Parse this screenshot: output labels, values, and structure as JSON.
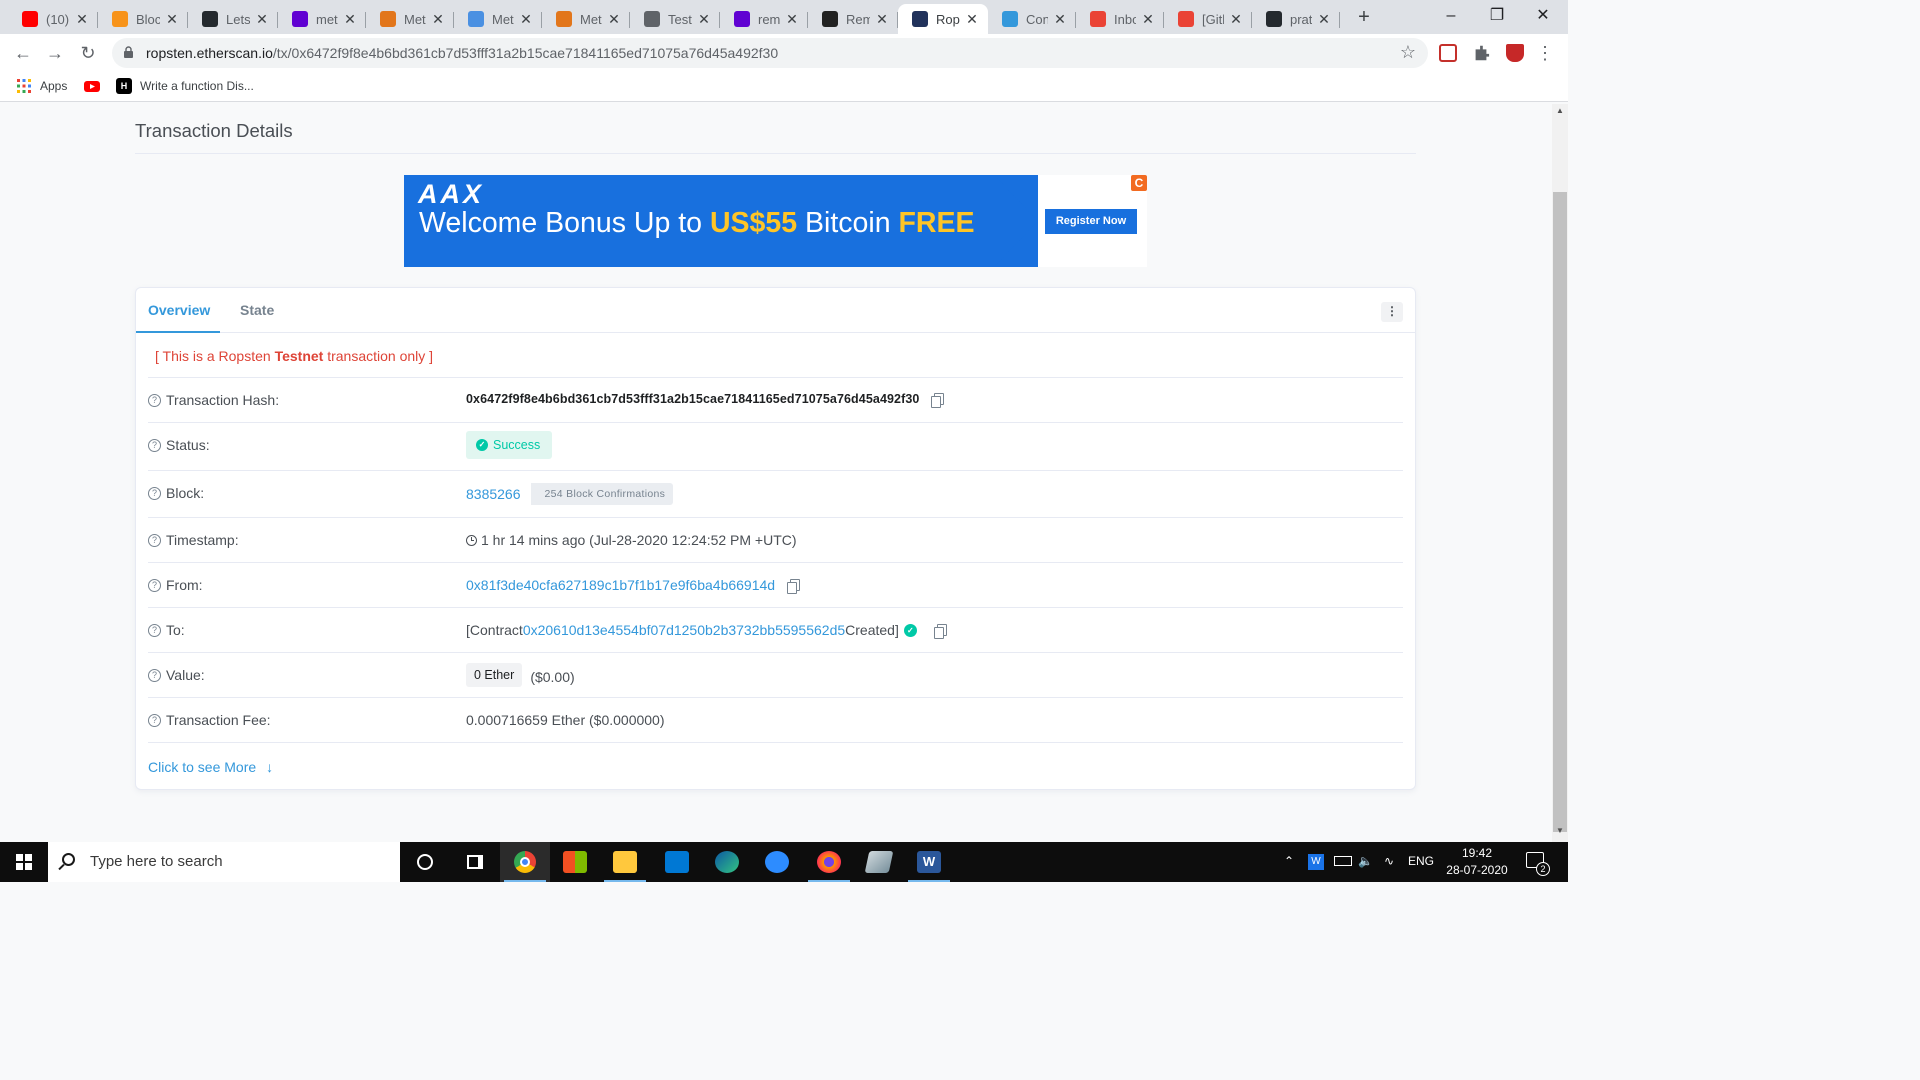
{
  "browser": {
    "tabs": [
      {
        "label": "(10)",
        "favicon": "youtube-icon",
        "color": "#ff0000",
        "active": false
      },
      {
        "label": "Bloc",
        "favicon": "blockchain-icon",
        "color": "#f7931a",
        "active": false
      },
      {
        "label": "Lets",
        "favicon": "github-icon",
        "color": "#24292e",
        "active": false
      },
      {
        "label": "met",
        "favicon": "yahoo-icon",
        "color": "#6001d2",
        "active": false
      },
      {
        "label": "Met",
        "favicon": "metamask-icon",
        "color": "#e2761b",
        "active": false
      },
      {
        "label": "Met",
        "favicon": "rainbow-icon",
        "color": "#4a90e2",
        "active": false
      },
      {
        "label": "Met",
        "favicon": "metamask-icon",
        "color": "#e2761b",
        "active": false
      },
      {
        "label": "Test",
        "favicon": "globe-icon",
        "color": "#5f6368",
        "active": false
      },
      {
        "label": "remi",
        "favicon": "yahoo-icon",
        "color": "#6001d2",
        "active": false
      },
      {
        "label": "Rem",
        "favicon": "remix-icon",
        "color": "#222222",
        "active": false
      },
      {
        "label": "Rop",
        "favicon": "etherscan-icon",
        "color": "#21325b",
        "active": true
      },
      {
        "label": "Con",
        "favicon": "etherscan-icon",
        "color": "#3498db",
        "active": false
      },
      {
        "label": "Inbo",
        "favicon": "gmail-icon",
        "color": "#ea4335",
        "active": false
      },
      {
        "label": "[Gith",
        "favicon": "gmail-icon",
        "color": "#ea4335",
        "active": false
      },
      {
        "label": "prat",
        "favicon": "github-icon",
        "color": "#24292e",
        "active": false
      }
    ],
    "url_host": "ropsten.etherscan.io",
    "url_path": "/tx/0x6472f9f8e4b6bd361cb7d53fff31a2b15cae71841165ed71075a76d45a492f30",
    "bookmarks": [
      {
        "label": "Apps",
        "icon": "apps-grid-icon"
      },
      {
        "label": "",
        "icon": "youtube-icon"
      },
      {
        "label": "Write a function Dis...",
        "icon": "hackerearth-icon"
      }
    ]
  },
  "page": {
    "title": "Transaction Details",
    "ad": {
      "logo": "AAX",
      "headline_pre": "Welcome Bonus Up to ",
      "headline_amount": "US$55",
      "headline_mid": " Bitcoin ",
      "headline_free": "FREE",
      "cta": "Register Now",
      "badge": "C"
    },
    "tabs": [
      "Overview",
      "State"
    ],
    "testnet_pre": "[ This is a Ropsten ",
    "testnet_bold": "Testnet",
    "testnet_post": " transaction only ]",
    "rows": {
      "hash_label": "Transaction Hash:",
      "hash_value": "0x6472f9f8e4b6bd361cb7d53fff31a2b15cae71841165ed71075a76d45a492f30",
      "status_label": "Status:",
      "status_value": "Success",
      "block_label": "Block:",
      "block_value": "8385266",
      "block_confirmations": "254 Block Confirmations",
      "timestamp_label": "Timestamp:",
      "timestamp_value": "1 hr 14 mins ago (Jul-28-2020 12:24:52 PM +UTC)",
      "from_label": "From:",
      "from_value": "0x81f3de40cfa627189c1b7f1b17e9f6ba4b66914d",
      "to_label": "To:",
      "to_pre": "[Contract ",
      "to_address": "0x20610d13e4554bf07d1250b2b3732bb5595562d5",
      "to_post": " Created]",
      "value_label": "Value:",
      "value_ether": "0 Ether",
      "value_usd": "($0.00)",
      "fee_label": "Transaction Fee:",
      "fee_value": "0.000716659 Ether ($0.000000)"
    },
    "more": "Click to see More"
  },
  "taskbar": {
    "search_placeholder": "Type here to search",
    "lang": "ENG",
    "time": "19:42",
    "date": "28-07-2020",
    "notifications": "2"
  }
}
